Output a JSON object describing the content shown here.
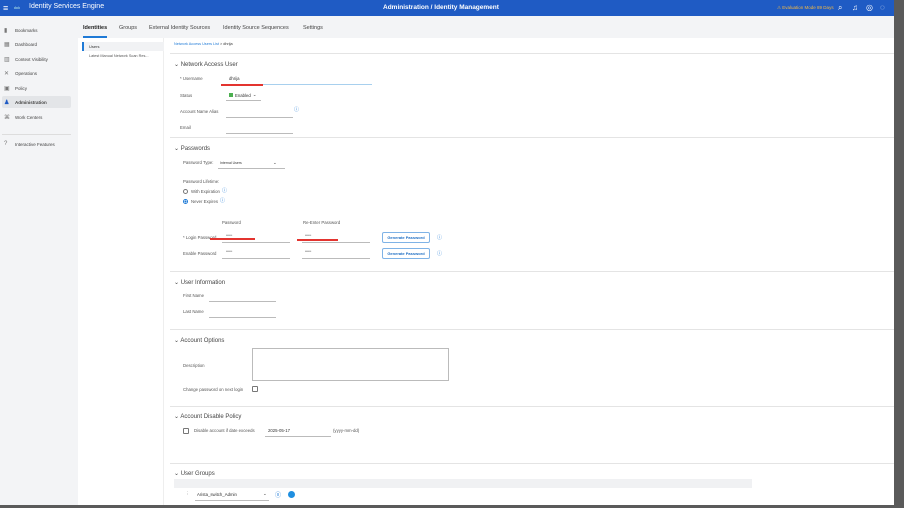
{
  "header": {
    "menu_icon": "hamburger-icon",
    "logo": "cisco",
    "app_title": "Identity Services Engine",
    "breadcrumb": "Administration / Identity Management",
    "evaluation": "⚠ Evaluation Mode 89 Days",
    "icons": [
      "search-icon",
      "bell-icon",
      "help-icon",
      "notification-icon"
    ]
  },
  "sidebar": {
    "items": [
      {
        "label": "Bookmarks",
        "icon": "▮"
      },
      {
        "label": "Dashboard",
        "icon": "▦"
      },
      {
        "label": "Context Visibility",
        "icon": "▥"
      },
      {
        "label": "Operations",
        "icon": "✕"
      },
      {
        "label": "Policy",
        "icon": "▣"
      },
      {
        "label": "Administration",
        "icon": "♟"
      },
      {
        "label": "Work Centers",
        "icon": "⌘"
      }
    ],
    "interactive": {
      "label": "Interactive Features",
      "icon": "?"
    }
  },
  "tabs": [
    "Identities",
    "Groups",
    "External Identity Sources",
    "Identity Source Sequences",
    "Settings"
  ],
  "subnav": {
    "users": "Users",
    "scan": "Latest Manual Network Scan Res..."
  },
  "breadcrumb": {
    "list": "Network Access Users List",
    "sep": ">",
    "current": "dhrija"
  },
  "nau": {
    "title": "Network Access User",
    "username_label": "* Username",
    "username": "dhrija",
    "status_label": "Status",
    "status": "Enabled",
    "alias_label": "Account Name Alias",
    "email_label": "Email"
  },
  "passwords": {
    "title": "Passwords",
    "type_label": "Password Type:",
    "type": "Internal Users",
    "lifetime_label": "Password Lifetime:",
    "with_exp": "With Expiration",
    "never": "Never Expires",
    "col_password": "Password",
    "col_reenter": "Re-Enter Password",
    "login_label": "* Login Password",
    "enable_label": "Enable Password",
    "masked": "••••••",
    "generate": "Generate Password"
  },
  "user_info": {
    "title": "User Information",
    "first": "First Name",
    "last": "Last Name"
  },
  "account_options": {
    "title": "Account Options",
    "description": "Description",
    "change_pw": "Change password on next login"
  },
  "disable_policy": {
    "title": "Account Disable Policy",
    "label": "Disable account if date exceeds",
    "date": "2025-05-17",
    "format": "(yyyy-mm-dd)"
  },
  "user_groups": {
    "title": "User Groups",
    "group": "Arista_switch_Admin"
  }
}
